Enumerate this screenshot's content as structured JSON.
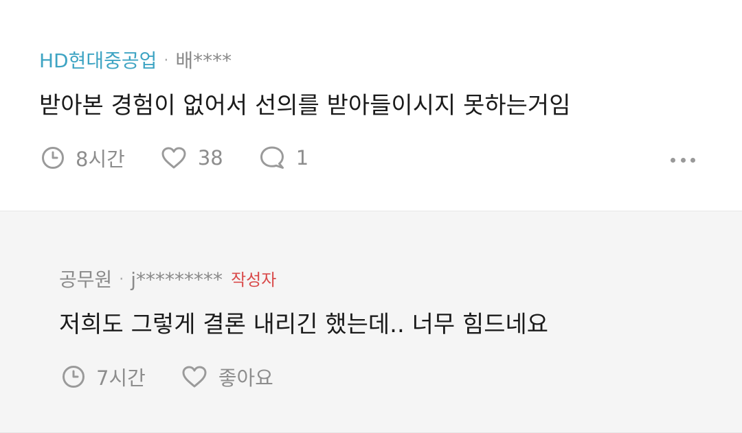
{
  "comment": {
    "company": "HD현대중공업",
    "separator": "·",
    "nickname": "배****",
    "text": "받아본 경험이 없어서 선의를 받아들이시지 못하는거임",
    "time": "8시간",
    "likes": "38",
    "replies": "1",
    "more_icon": "more-dots-icon",
    "accent_color": "#3ea4c3"
  },
  "reply": {
    "company": "공무원",
    "separator": "·",
    "nickname": "j*********",
    "author_badge": "작성자",
    "text": "저희도 그렇게 결론 내리긴 했는데.. 너무 힘드네요",
    "time": "7시간",
    "like_label": "좋아요",
    "badge_color": "#d94a4a",
    "background": "#f5f5f5"
  },
  "icons": {
    "time": "clock-icon",
    "like": "heart-icon",
    "reply": "speech-bubble-icon"
  }
}
